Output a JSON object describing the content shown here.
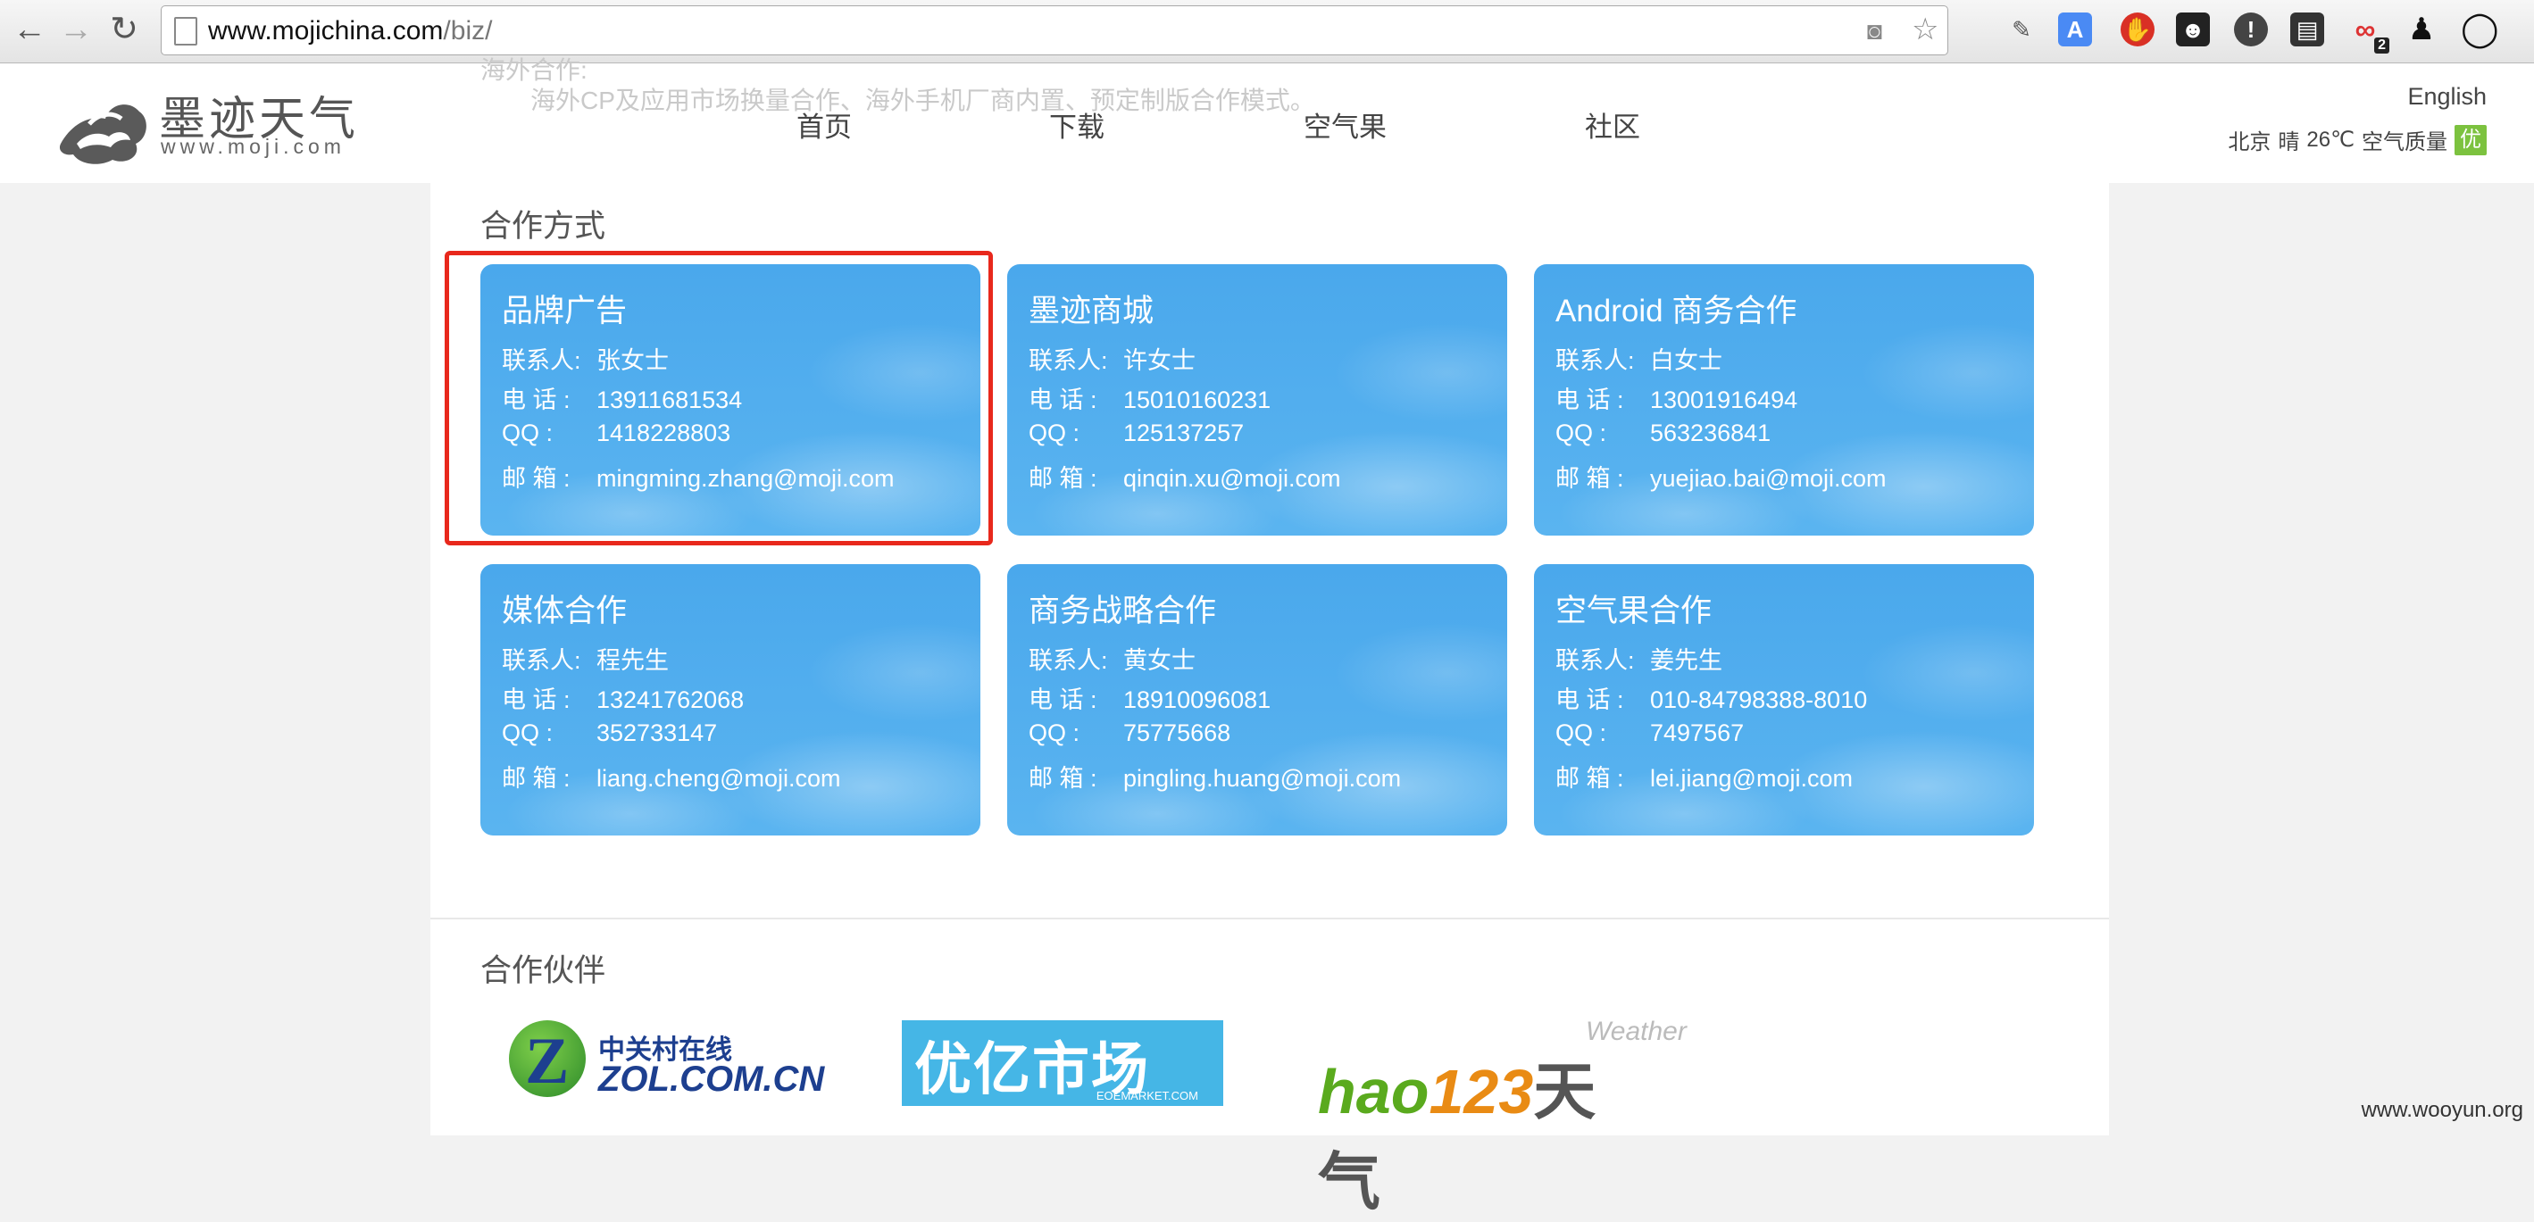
{
  "browser": {
    "url_host": "www.mojichina.com",
    "url_path": "/biz/"
  },
  "header": {
    "ghost_title": "海外合作:",
    "ghost_text": "海外CP及应用市场换量合作、海外手机厂商内置、预定制版合作模式。",
    "logo_cn": "墨迹天气",
    "logo_en": "www.moji.com",
    "nav": [
      "首页",
      "下载",
      "空气果",
      "社区"
    ],
    "lang": "English",
    "weather": {
      "city": "北京",
      "condition": "晴",
      "temp": "26℃",
      "aq_label": "空气质量",
      "aq_value": "优",
      "aq_color": "#7cc23f"
    }
  },
  "cooperation": {
    "title": "合作方式",
    "labels": {
      "contact": "联系人:",
      "phone": "电 话 :",
      "qq": "QQ  :",
      "email": "邮 箱 :"
    },
    "cards": [
      {
        "title": "品牌广告",
        "contact": "张女士",
        "phone": "13911681534",
        "qq": "1418228803",
        "email": "mingming.zhang@moji.com"
      },
      {
        "title": "墨迹商城",
        "contact": "许女士",
        "phone": "15010160231",
        "qq": "125137257",
        "email": "qinqin.xu@moji.com"
      },
      {
        "title": "Android 商务合作",
        "contact": "白女士",
        "phone": "13001916494",
        "qq": "563236841",
        "email": "yuejiao.bai@moji.com"
      },
      {
        "title": "媒体合作",
        "contact": "程先生",
        "phone": "13241762068",
        "qq": "352733147",
        "email": "liang.cheng@moji.com"
      },
      {
        "title": "商务战略合作",
        "contact": "黄女士",
        "phone": "18910096081",
        "qq": "75775668",
        "email": "pingling.huang@moji.com"
      },
      {
        "title": "空气果合作",
        "contact": "姜先生",
        "phone": "010-84798388-8010",
        "qq": "7497567",
        "email": "lei.jiang@moji.com"
      }
    ],
    "highlight_color": "#e8281c"
  },
  "partners": {
    "title": "合作伙伴",
    "zol": {
      "top": "中关村在线",
      "bottom": "ZOL.COM.CN"
    },
    "eoe": {
      "main": "优亿市场",
      "sub": "EOEMARKET.COM"
    },
    "hao123": {
      "weather": "Weather",
      "h": "h",
      "a": "ao",
      "n": "123",
      "cn": "天气"
    }
  },
  "watermark": "www.wooyun.org",
  "colors": {
    "card_blue": "#4aa8ec",
    "brand_gray": "#555555"
  }
}
